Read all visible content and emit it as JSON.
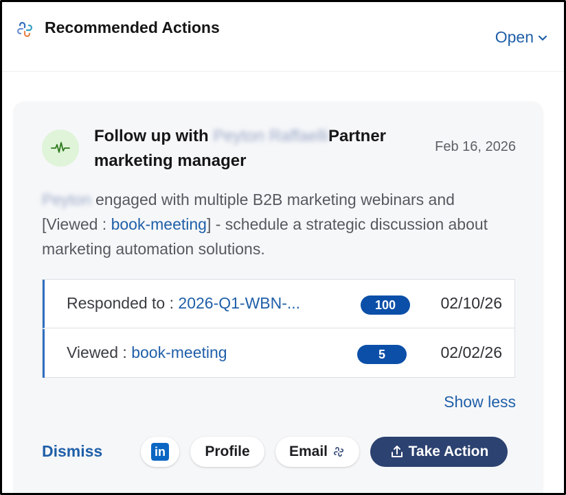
{
  "header": {
    "title": "Recommended Actions",
    "status": "Open"
  },
  "card": {
    "title_prefix": "Follow up with",
    "contact_name_redacted": "Peyton Raffaelli",
    "title_suffix": "Partner marketing manager",
    "date": "Feb 16, 2026",
    "description": {
      "name_redacted": "Peyton",
      "text_1": " engaged with multiple B2B marketing webinars and [Viewed : ",
      "link": "book-meeting",
      "text_2": "] - schedule a strategic discussion about marketing automation solutions."
    },
    "events": [
      {
        "label": "Responded to : ",
        "link": "2026-Q1-WBN-...",
        "count": "100",
        "date": "02/10/26"
      },
      {
        "label": "Viewed : ",
        "link": "book-meeting",
        "count": "5",
        "date": "02/02/26"
      }
    ],
    "show_less": "Show less",
    "actions": {
      "dismiss": "Dismiss",
      "linkedin": "in",
      "profile": "Profile",
      "email": "Email",
      "take_action": "Take Action"
    }
  },
  "colors": {
    "link": "#1f5fa8",
    "primary_button": "#2c4270",
    "count_badge": "#0b4fa8",
    "activity_badge_bg": "#dff4d8",
    "linkedin": "#0a66c2"
  },
  "icons": {
    "app_logo": "app-logo-icon",
    "status_chevron": "chevron-down-icon",
    "activity": "activity-pulse-icon",
    "linkedin": "linkedin-icon",
    "email": "ai-sparkle-icon",
    "take_action": "share-upload-icon"
  }
}
